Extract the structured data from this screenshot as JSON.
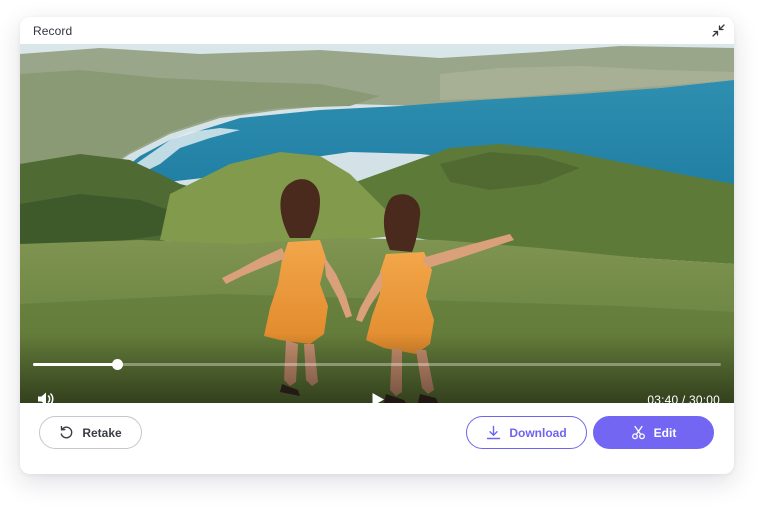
{
  "window": {
    "title": "Record"
  },
  "player": {
    "current_time": "03:40",
    "duration": "30:00",
    "time_display": "03:40 / 30:00",
    "progress_fraction": 0.122
  },
  "actions": {
    "retake_label": "Retake",
    "download_label": "Download",
    "edit_label": "Edit"
  },
  "icons": {
    "collapse": "collapse-icon",
    "volume": "volume-icon",
    "play": "play-icon",
    "retake": "retake-icon",
    "download": "download-icon",
    "edit": "scissors-icon"
  },
  "colors": {
    "accent": "#7366f2",
    "text": "#333640",
    "border": "#c6c7cc"
  }
}
